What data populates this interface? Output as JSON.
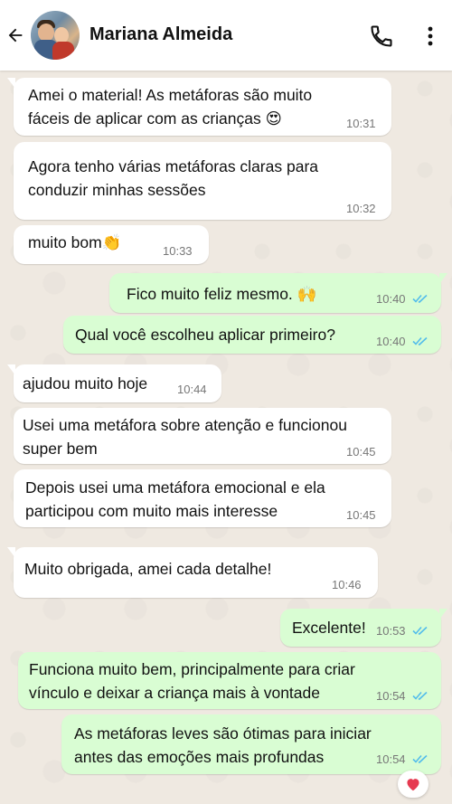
{
  "header": {
    "contact_name": "Mariana Almeida",
    "icons": [
      "back-arrow-icon",
      "phone-icon",
      "more-vertical-icon"
    ]
  },
  "colors": {
    "incoming_bubble": "#ffffff",
    "outgoing_bubble": "#d9fdd3",
    "read_ticks": "#53bdeb"
  },
  "messages": [
    {
      "direction": "in",
      "line1": "Amei o material! As metáforas são muito",
      "line2": "fáceis de aplicar com as crianças 😍",
      "time": "10:31"
    },
    {
      "direction": "in",
      "line1": "Agora tenho várias metáforas claras para",
      "line2": "conduzir minhas sessões",
      "time": "10:32"
    },
    {
      "direction": "in",
      "line1": "muito bom👏",
      "time": "10:33"
    },
    {
      "direction": "out",
      "line1": "Fico muito feliz mesmo. 🙌",
      "time": "10:40",
      "status": "read"
    },
    {
      "direction": "out",
      "line1": "Qual você escolheu aplicar primeiro?",
      "time": "10:40",
      "status": "read"
    },
    {
      "direction": "in",
      "line1": "ajudou muito hoje",
      "time": "10:44"
    },
    {
      "direction": "in",
      "line1": "Usei uma metáfora sobre atenção e funcionou",
      "line2": "super bem",
      "time": "10:45"
    },
    {
      "direction": "in",
      "line1": "Depois usei uma metáfora emocional e ela",
      "line2": "participou com muito mais interesse",
      "time": "10:45"
    },
    {
      "direction": "in",
      "line1": "Muito obrigada, amei cada detalhe!",
      "time": "10:46"
    },
    {
      "direction": "out",
      "line1": "Excelente!",
      "time": "10:53",
      "status": "read"
    },
    {
      "direction": "out",
      "line1": "Funciona muito bem, principalmente para criar",
      "line2": "vínculo e deixar a criança mais à vontade",
      "time": "10:54",
      "status": "read"
    },
    {
      "direction": "out",
      "line1": "As metáforas leves são ótimas para iniciar",
      "line2": "antes das emoções mais profundas",
      "time": "10:54",
      "status": "read",
      "reaction": "❤️"
    }
  ]
}
